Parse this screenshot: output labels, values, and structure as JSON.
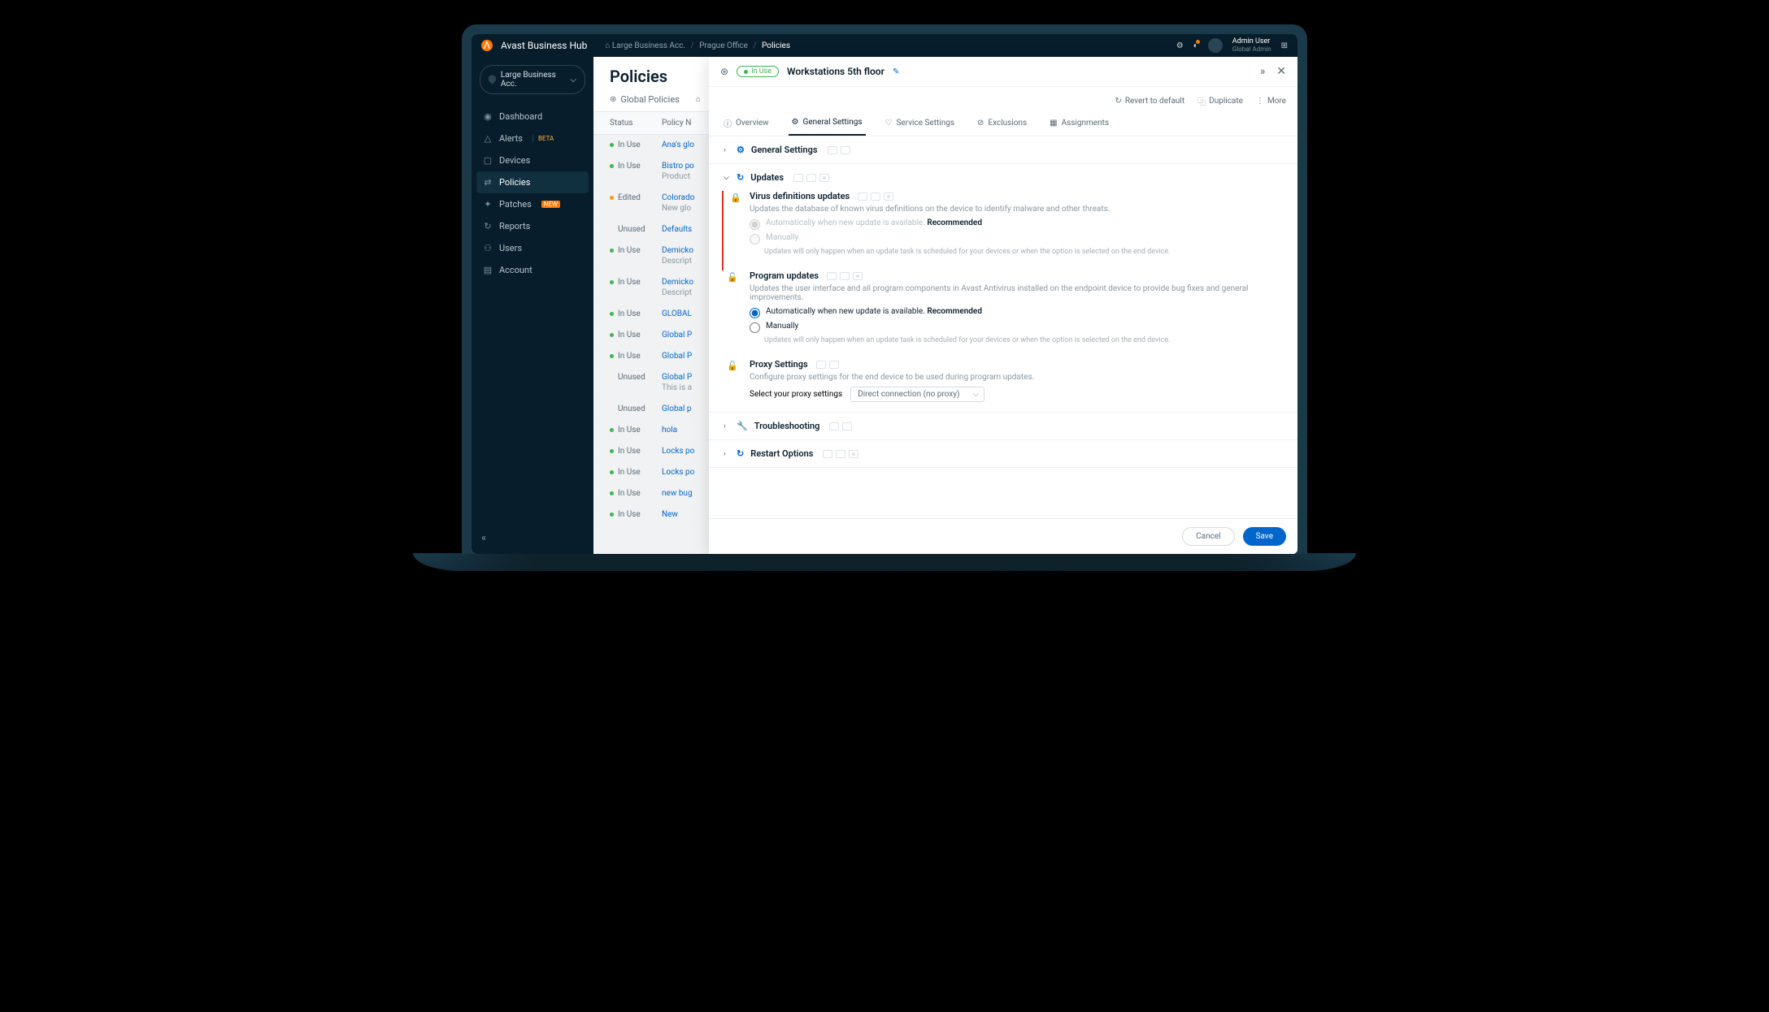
{
  "brand": "Avast Business Hub",
  "breadcrumb": {
    "account": "Large Business Acc.",
    "office": "Prague Office",
    "page": "Policies"
  },
  "user": {
    "name": "Admin User",
    "role": "Global Admin"
  },
  "account_selector": "Large Business Acc.",
  "sidebar": {
    "items": [
      {
        "icon": "◉",
        "label": "Dashboard"
      },
      {
        "icon": "△",
        "label": "Alerts",
        "badge": "BETA",
        "badge_cls": "beta"
      },
      {
        "icon": "▢",
        "label": "Devices"
      },
      {
        "icon": "⇄",
        "label": "Policies",
        "active": true
      },
      {
        "icon": "✦",
        "label": "Patches",
        "badge": "NEW",
        "badge_cls": "new"
      },
      {
        "icon": "↻",
        "label": "Reports"
      },
      {
        "icon": "⚇",
        "label": "Users"
      },
      {
        "icon": "▤",
        "label": "Account"
      }
    ]
  },
  "page_title": "Policies",
  "main_tabs": [
    {
      "icon": "⊛",
      "label": "Global Policies"
    },
    {
      "icon": "⌂",
      "label": ""
    }
  ],
  "grid": {
    "cols": [
      "Status",
      "Policy N"
    ],
    "rows": [
      {
        "s": "inuse",
        "st": "In Use",
        "n": "Ana's glo"
      },
      {
        "s": "inuse",
        "st": "In Use",
        "n": "Bistro po",
        "d": "Product"
      },
      {
        "s": "edited",
        "st": "Edited",
        "n": "Colorado",
        "d": "New glo"
      },
      {
        "s": "unused",
        "st": "Unused",
        "n": "Defaults"
      },
      {
        "s": "inuse",
        "st": "In Use",
        "n": "Demicko",
        "d": "Descript"
      },
      {
        "s": "inuse",
        "st": "In Use",
        "n": "Demicko",
        "d": "Descript"
      },
      {
        "s": "inuse",
        "st": "In Use",
        "n": "GLOBAL"
      },
      {
        "s": "inuse",
        "st": "In Use",
        "n": "Global P"
      },
      {
        "s": "inuse",
        "st": "In Use",
        "n": "Global P"
      },
      {
        "s": "unused",
        "st": "Unused",
        "n": "Global P",
        "d": "This is a"
      },
      {
        "s": "unused",
        "st": "Unused",
        "n": "Global p"
      },
      {
        "s": "inuse",
        "st": "In Use",
        "n": "hola"
      },
      {
        "s": "inuse",
        "st": "In Use",
        "n": "Locks po"
      },
      {
        "s": "inuse",
        "st": "In Use",
        "n": "Locks po"
      },
      {
        "s": "inuse",
        "st": "In Use",
        "n": "new bug"
      },
      {
        "s": "inuse",
        "st": "In Use",
        "n": "New"
      }
    ]
  },
  "drawer": {
    "status": "In Use",
    "title": "Workstations 5th floor",
    "actions": {
      "revert": "Revert to default",
      "duplicate": "Duplicate",
      "more": "More"
    },
    "subtabs": [
      {
        "ic": "ⓘ",
        "l": "Overview"
      },
      {
        "ic": "⚙",
        "l": "General Settings",
        "active": true
      },
      {
        "ic": "♡",
        "l": "Service Settings"
      },
      {
        "ic": "⊘",
        "l": "Exclusions"
      },
      {
        "ic": "▦",
        "l": "Assignments"
      }
    ],
    "sections": {
      "general": {
        "title": "General Settings"
      },
      "updates": {
        "title": "Updates",
        "virus": {
          "title": "Virus definitions updates",
          "desc": "Updates the database of known virus definitions on the device to identify malware and other threats.",
          "auto": "Automatically when new update is available.",
          "rec": "Recommended",
          "manual": "Manually",
          "sub": "Updates will only happen when an update task is scheduled for your devices or when the option is selected on the end device."
        },
        "program": {
          "title": "Program updates",
          "desc": "Updates the user interface and all program components in Avast Antivirus installed on the endpoint device to provide bug fixes and general improvements.",
          "auto": "Automatically when new update is available.",
          "rec": "Recommended",
          "manual": "Manually",
          "sub": "Updates will only happen when an update task is scheduled for your devices or when the option is selected on the end device."
        },
        "proxy": {
          "title": "Proxy Settings",
          "desc": "Configure proxy settings for the end device to be used during program updates.",
          "label": "Select your proxy settings",
          "value": "Direct connection (no proxy)"
        }
      },
      "troubleshoot": {
        "title": "Troubleshooting"
      },
      "restart": {
        "title": "Restart Options"
      }
    },
    "footer": {
      "cancel": "Cancel",
      "save": "Save"
    }
  }
}
